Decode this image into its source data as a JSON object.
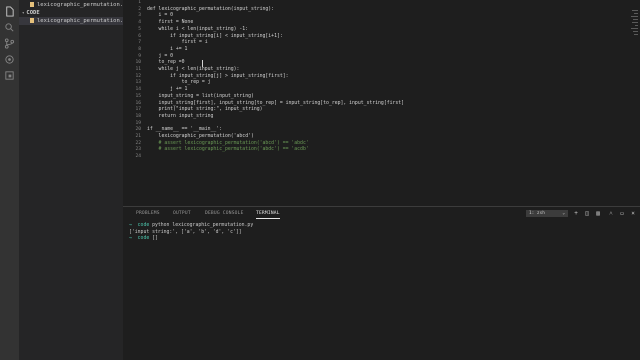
{
  "sidebar": {
    "items": [
      {
        "label": "lexicographic_permutation.py",
        "icon": "python-file-icon"
      },
      {
        "label": "CODE",
        "icon": "chevron-down-icon"
      },
      {
        "label": "lexicographic_permutation.py",
        "icon": "python-file-icon"
      }
    ]
  },
  "editor": {
    "line_numbers": [
      "1",
      "2",
      "3",
      "4",
      "5",
      "6",
      "7",
      "8",
      "9",
      "10",
      "11",
      "12",
      "13",
      "14",
      "15",
      "16",
      "17",
      "18",
      "19",
      "20",
      "21",
      "22",
      "23",
      "24"
    ],
    "lines": [
      "",
      "def lexicographic_permutation(input_string):",
      "    i = 0",
      "    first = None",
      "    while i < len(input_string) -1:",
      "        if input_string[i] < input_string[i+1]:",
      "            first = i",
      "        i += 1",
      "    j = 0",
      "    to_rep =0",
      "    while j < len(input_string):",
      "        if input_string[j] > input_string[first]:",
      "            to_rep = j",
      "        j += 1",
      "    input_string = list(input_string)",
      "    input_string[first], input_string[to_rep] = input_string[to_rep], input_string[first]",
      "    print(\"input string:\", input_string)",
      "    return input_string",
      "",
      "if __name__ == '__main__':",
      "    lexicographic_permutation('abcd')",
      "    # assert lexicographic_permutation('abcd') == 'abdc'",
      "    # assert lexicographic_permutation('abdc') == 'acdb'",
      ""
    ]
  },
  "panel": {
    "tabs": [
      "PROBLEMS",
      "OUTPUT",
      "DEBUG CONSOLE",
      "TERMINAL"
    ],
    "active_tab": "TERMINAL",
    "terminal_select": "1: zsh",
    "terminal_lines": [
      {
        "arrow": "→",
        "cwd": "code",
        "text": " python lexicographic_permutation.py"
      },
      {
        "arrow": "",
        "cwd": "",
        "text": "['input string:', ['a', 'b', 'd', 'c']]"
      },
      {
        "arrow": "→",
        "cwd": "code",
        "text": " []"
      }
    ]
  },
  "colors": {
    "accent": "#007acc",
    "background": "#1e1e1e"
  }
}
